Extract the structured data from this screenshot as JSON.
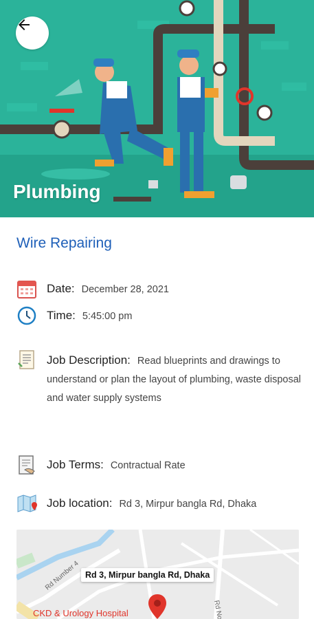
{
  "header": {
    "category": "Plumbing",
    "back_icon": "arrow-left-icon"
  },
  "job": {
    "title": "Wire Repairing",
    "date_label": "Date:",
    "date_value": "December 28, 2021",
    "time_label": "Time:",
    "time_value": "5:45:00 pm",
    "description_label": "Job Description:",
    "description_value": "Read blueprints and drawings to understand or plan the layout of plumbing, waste disposal and water supply systems",
    "terms_label": "Job Terms:",
    "terms_value": "Contractual Rate",
    "location_label": "Job location:",
    "location_value": "Rd 3, Mirpur bangla Rd, Dhaka"
  },
  "map": {
    "tooltip": "Rd 3, Mirpur bangla Rd, Dhaka",
    "road_label_1": "Rd Number 4",
    "road_label_2": "Rd No",
    "poi_label": "CKD & Urology Hospital"
  },
  "colors": {
    "hero_bg": "#2bb39a",
    "title_blue": "#1e5fb8",
    "pin_red": "#e0352b"
  }
}
